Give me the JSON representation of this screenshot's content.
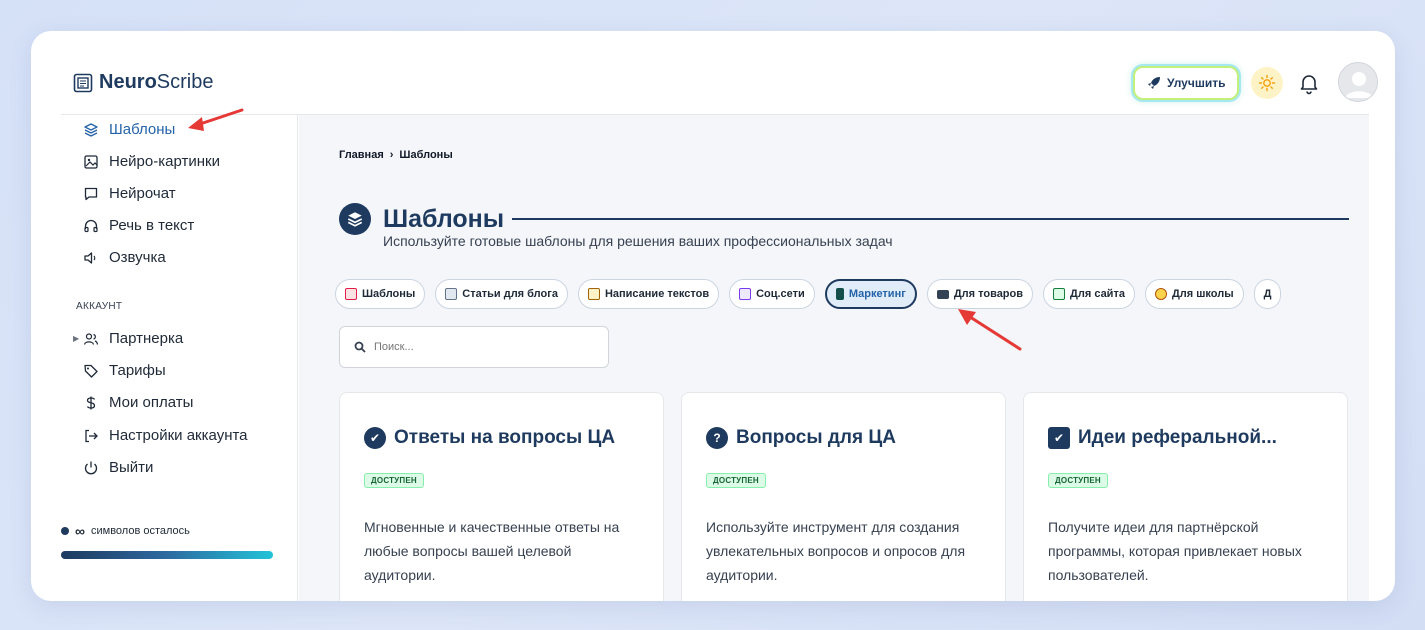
{
  "header": {
    "logo_bold": "Neuro",
    "logo_light": "Scribe",
    "upgrade_label": "Улучшить"
  },
  "sidebar": {
    "items": [
      {
        "label": "Шаблоны",
        "icon": "layers-icon",
        "active": true
      },
      {
        "label": "Нейро-картинки",
        "icon": "image-icon"
      },
      {
        "label": "Нейрочат",
        "icon": "chat-icon"
      },
      {
        "label": "Речь в текст",
        "icon": "headphones-icon"
      },
      {
        "label": "Озвучка",
        "icon": "speaker-icon"
      }
    ],
    "section_label": "АККАУНТ",
    "account_items": [
      {
        "label": "Партнерка",
        "icon": "users-icon"
      },
      {
        "label": "Тарифы",
        "icon": "tag-icon"
      },
      {
        "label": "Мои оплаты",
        "icon": "dollar-icon"
      },
      {
        "label": "Настройки аккаунта",
        "icon": "login-icon"
      },
      {
        "label": "Выйти",
        "icon": "power-icon"
      }
    ],
    "credits_symbol": "∞",
    "credits_text": "символов осталось"
  },
  "main": {
    "breadcrumb": {
      "home": "Главная",
      "sep": "›",
      "current": "Шаблоны"
    },
    "title": "Шаблоны",
    "subtitle": "Используйте готовые шаблоны для решения ваших профессиональных задач",
    "chips": [
      {
        "label": "Шаблоны",
        "color": "#e11d48"
      },
      {
        "label": "Статьи для блога",
        "color": "#64748b"
      },
      {
        "label": "Написание текстов",
        "color": "#a16207"
      },
      {
        "label": "Соц.сети",
        "color": "#7c3aed"
      },
      {
        "label": "Маркетинг",
        "color": "#0f766e",
        "active": true
      },
      {
        "label": "Для товаров",
        "color": "#334155"
      },
      {
        "label": "Для сайта",
        "color": "#15803d"
      },
      {
        "label": "Для школы",
        "color": "#b45309"
      },
      {
        "label": "Д",
        "color": "#64748b"
      }
    ],
    "search_placeholder": "Поиск...",
    "cards": [
      {
        "title": "Ответы на вопросы ЦА",
        "icon_glyph": "✔",
        "badge": "ДОСТУПЕН",
        "desc": "Мгновенные и качественные ответы на любые вопросы вашей целевой аудитории."
      },
      {
        "title": "Вопросы для ЦА",
        "icon_glyph": "?",
        "badge": "ДОСТУПЕН",
        "desc": "Используйте инструмент для создания увлекательных вопросов и опросов для аудитории."
      },
      {
        "title": "Идеи реферальной...",
        "icon_glyph": "✔",
        "badge": "ДОСТУПЕН",
        "desc": "Получите идеи для партнёрской программы, которая привлекает новых пользователей."
      }
    ]
  },
  "colors": {
    "accent": "#1e3a5f",
    "link": "#2563a8",
    "annotation": "#e53935"
  }
}
